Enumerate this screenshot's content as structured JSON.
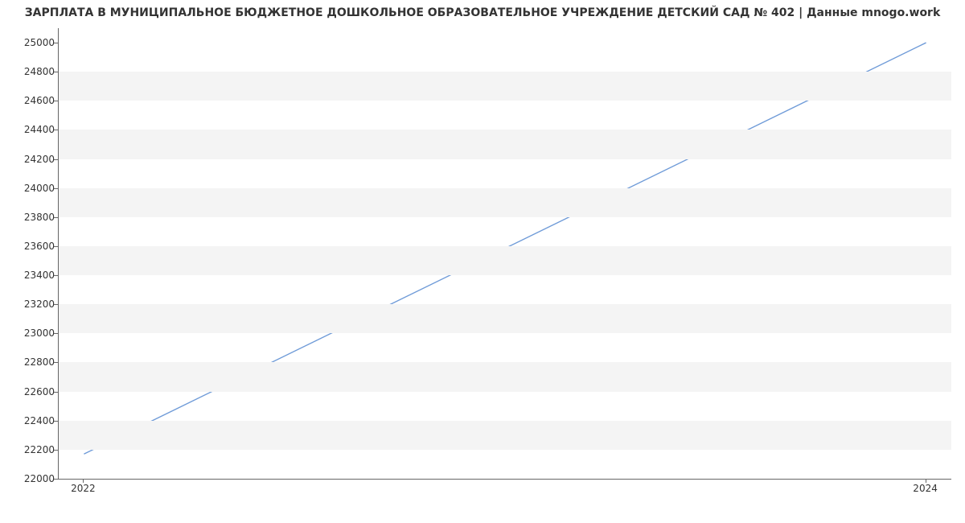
{
  "chart_data": {
    "type": "line",
    "title": "ЗАРПЛАТА В МУНИЦИПАЛЬНОЕ БЮДЖЕТНОЕ ДОШКОЛЬНОЕ ОБРАЗОВАТЕЛЬНОЕ УЧРЕЖДЕНИЕ ДЕТСКИЙ САД № 402 | Данные mnogo.work",
    "x": [
      2022,
      2024
    ],
    "values": [
      22170,
      25000
    ],
    "x_ticks": [
      2022,
      2024
    ],
    "y_ticks": [
      22000,
      22200,
      22400,
      22600,
      22800,
      23000,
      23200,
      23400,
      23600,
      23800,
      24000,
      24200,
      24400,
      24600,
      24800,
      25000
    ],
    "xlabel": "",
    "ylabel": "",
    "ylim": [
      22000,
      25100
    ],
    "xlim": [
      2021.94,
      2024.06
    ],
    "line_color": "#6f9bd8"
  }
}
